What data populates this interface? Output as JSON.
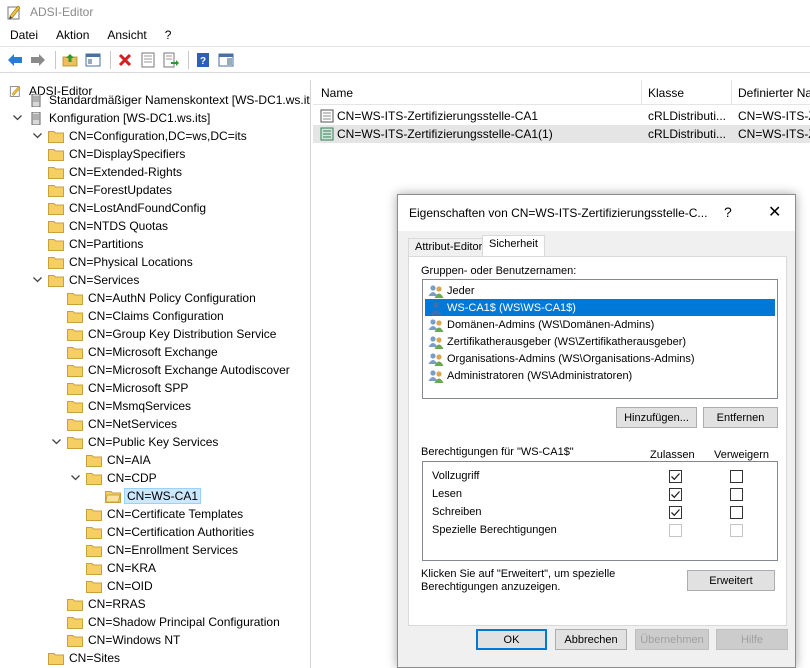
{
  "window": {
    "title": "ADSI-Editor"
  },
  "menu": [
    {
      "label": "Datei"
    },
    {
      "label": "Aktion"
    },
    {
      "label": "Ansicht"
    },
    {
      "label": "?"
    }
  ],
  "tree": {
    "root": "ADSI-Editor",
    "nodes": [
      {
        "label": "Standardmäßiger Namenskontext [WS-DC1.ws.its]"
      },
      {
        "label": "Konfiguration [WS-DC1.ws.its]"
      },
      {
        "label": "CN=Configuration,DC=ws,DC=its"
      },
      {
        "label": "CN=DisplaySpecifiers"
      },
      {
        "label": "CN=Extended-Rights"
      },
      {
        "label": "CN=ForestUpdates"
      },
      {
        "label": "CN=LostAndFoundConfig"
      },
      {
        "label": "CN=NTDS Quotas"
      },
      {
        "label": "CN=Partitions"
      },
      {
        "label": "CN=Physical Locations"
      },
      {
        "label": "CN=Services"
      },
      {
        "label": "CN=AuthN Policy Configuration"
      },
      {
        "label": "CN=Claims Configuration"
      },
      {
        "label": "CN=Group Key Distribution Service"
      },
      {
        "label": "CN=Microsoft Exchange"
      },
      {
        "label": "CN=Microsoft Exchange Autodiscover"
      },
      {
        "label": "CN=Microsoft SPP"
      },
      {
        "label": "CN=MsmqServices"
      },
      {
        "label": "CN=NetServices"
      },
      {
        "label": "CN=Public Key Services"
      },
      {
        "label": "CN=AIA"
      },
      {
        "label": "CN=CDP"
      },
      {
        "label": "CN=WS-CA1"
      },
      {
        "label": "CN=Certificate Templates"
      },
      {
        "label": "CN=Certification Authorities"
      },
      {
        "label": "CN=Enrollment Services"
      },
      {
        "label": "CN=KRA"
      },
      {
        "label": "CN=OID"
      },
      {
        "label": "CN=RRAS"
      },
      {
        "label": "CN=Shadow Principal Configuration"
      },
      {
        "label": "CN=Windows NT"
      },
      {
        "label": "CN=Sites"
      }
    ]
  },
  "list": {
    "columns": [
      "Name",
      "Klasse",
      "Definierter Na"
    ],
    "rows": [
      {
        "name": "CN=WS-ITS-Zertifizierungsstelle-CA1",
        "klasse": "cRLDistributi...",
        "dn": "CN=WS-ITS-Z"
      },
      {
        "name": "CN=WS-ITS-Zertifizierungsstelle-CA1(1)",
        "klasse": "cRLDistributi...",
        "dn": "CN=WS-ITS-Z"
      }
    ]
  },
  "dialog": {
    "title": "Eigenschaften von CN=WS-ITS-Zertifizierungsstelle-C...",
    "help": "?",
    "close": "✕",
    "tabs": [
      "Attribut-Editor",
      "Sicherheit"
    ],
    "groups_label": "Gruppen- oder Benutzernamen:",
    "users": [
      {
        "name": "Jeder"
      },
      {
        "name": "WS-CA1$ (WS\\WS-CA1$)"
      },
      {
        "name": "Domänen-Admins (WS\\Domänen-Admins)"
      },
      {
        "name": "Zertifikatherausgeber (WS\\Zertifikatherausgeber)"
      },
      {
        "name": "Organisations-Admins (WS\\Organisations-Admins)"
      },
      {
        "name": "Administratoren (WS\\Administratoren)"
      }
    ],
    "add_button": "Hinzufügen...",
    "remove_button": "Entfernen",
    "permissions_label": "Berechtigungen für \"WS-CA1$\"",
    "allow_label": "Zulassen",
    "deny_label": "Verweigern",
    "permissions": [
      {
        "name": "Vollzugriff",
        "allow": true,
        "deny": false,
        "enabled": true
      },
      {
        "name": "Lesen",
        "allow": true,
        "deny": false,
        "enabled": true
      },
      {
        "name": "Schreiben",
        "allow": true,
        "deny": false,
        "enabled": true
      },
      {
        "name": "Spezielle Berechtigungen",
        "allow": false,
        "deny": false,
        "enabled": false
      }
    ],
    "advanced_text_1": "Klicken Sie auf \"Erweitert\", um spezielle",
    "advanced_text_2": "Berechtigungen anzuzeigen.",
    "advanced_button": "Erweitert",
    "ok_button": "OK",
    "cancel_button": "Abbrechen",
    "apply_button": "Übernehmen",
    "help_button": "Hilfe"
  },
  "colors": {
    "selection_blue": "#0078d7",
    "tree_selection": "#cce8ff",
    "folder_yellow": "#f5cf62"
  }
}
